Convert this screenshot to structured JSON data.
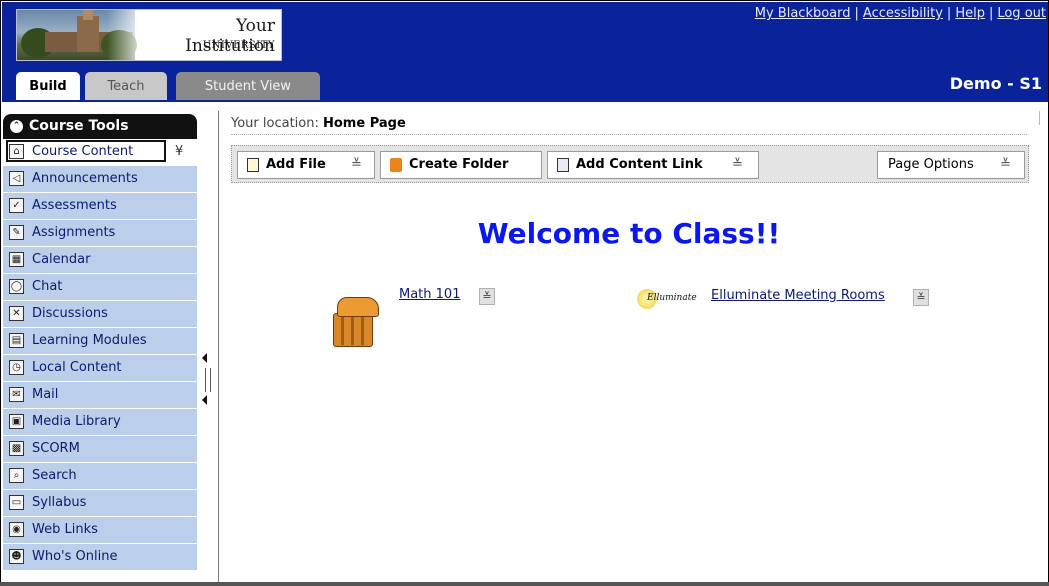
{
  "header": {
    "institution_name": "Your Institution",
    "institution_sub": "UNIVERSITY",
    "links": [
      "My Blackboard",
      "Accessibility",
      "Help",
      "Log out"
    ],
    "tabs": [
      {
        "label": "Build",
        "active": true
      },
      {
        "label": "Teach",
        "active": false
      },
      {
        "label": "Student View",
        "active": false
      }
    ],
    "course_name": "Demo - S1",
    "bg_color": "#0a239a"
  },
  "sidebar": {
    "title": "Course Tools",
    "items": [
      {
        "label": "Course Content",
        "icon": "home-icon",
        "selected": true
      },
      {
        "label": "Announcements",
        "icon": "megaphone-icon"
      },
      {
        "label": "Assessments",
        "icon": "assessment-icon"
      },
      {
        "label": "Assignments",
        "icon": "assignment-icon"
      },
      {
        "label": "Calendar",
        "icon": "calendar-icon"
      },
      {
        "label": "Chat",
        "icon": "chat-bubble-icon"
      },
      {
        "label": "Discussions",
        "icon": "pin-icon"
      },
      {
        "label": "Learning Modules",
        "icon": "module-icon"
      },
      {
        "label": "Local Content",
        "icon": "clock-icon"
      },
      {
        "label": "Mail",
        "icon": "envelope-icon"
      },
      {
        "label": "Media Library",
        "icon": "media-icon"
      },
      {
        "label": "SCORM",
        "icon": "scorm-icon"
      },
      {
        "label": "Search",
        "icon": "magnifier-icon"
      },
      {
        "label": "Syllabus",
        "icon": "syllabus-icon"
      },
      {
        "label": "Web Links",
        "icon": "globe-icon"
      },
      {
        "label": "Who's Online",
        "icon": "person-icon"
      }
    ],
    "item_bg": "#bccfea"
  },
  "main": {
    "location_prefix": "Your location:",
    "location": "Home Page",
    "actions": {
      "add_file": "Add File",
      "create_folder": "Create Folder",
      "add_content_link": "Add Content Link",
      "page_options": "Page Options"
    },
    "welcome": "Welcome to Class!!",
    "content_items": [
      {
        "label": "Math 101",
        "icon": "treasure-chest-icon"
      },
      {
        "label": "Elluminate Meeting Rooms",
        "icon": "elluminate-logo",
        "logo_text": "Elluminate"
      }
    ],
    "welcome_color": "#0a18ee"
  }
}
